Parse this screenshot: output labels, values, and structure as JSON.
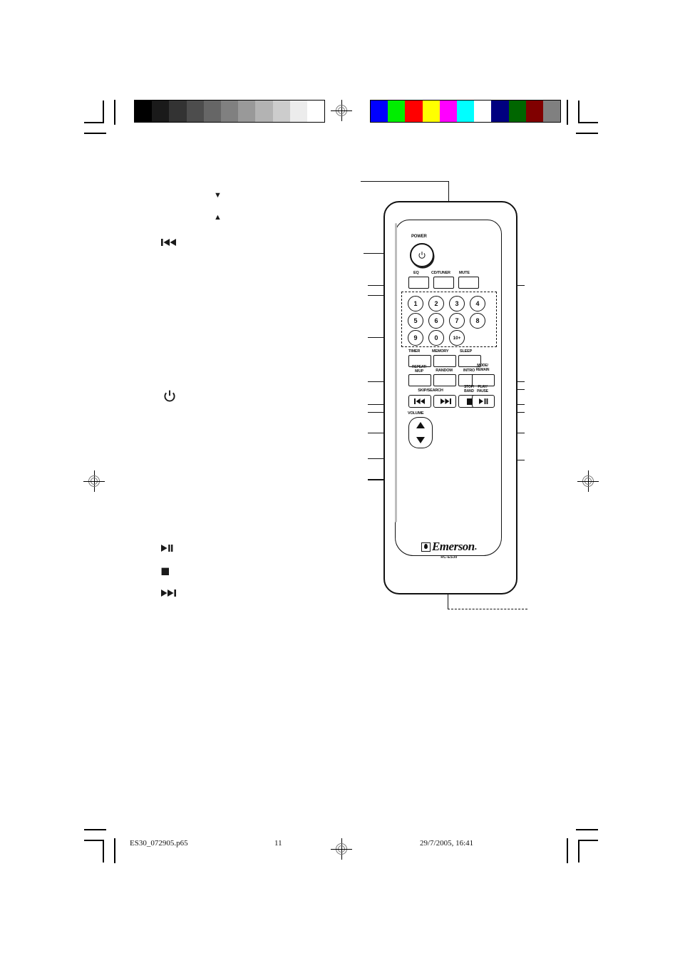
{
  "page": {
    "number": "11",
    "footer_file": "ES30_072905.p65",
    "footer_date": "29/7/2005, 16:41"
  },
  "calibration": {
    "grayscale_label": "grayscale-calibration-bar",
    "grayscale_swatches": [
      "#000000",
      "#1a1a1a",
      "#333333",
      "#4d4d4d",
      "#666666",
      "#808080",
      "#999999",
      "#b3b3b3",
      "#cccccc",
      "#ececec",
      "#ffffff"
    ],
    "color_label": "color-calibration-bar",
    "color_swatches": [
      "#0000ff",
      "#00ee00",
      "#ff0000",
      "#ffff00",
      "#ff00ff",
      "#00ffff",
      "#ffffff",
      "#000080",
      "#006600",
      "#800000",
      "#808080"
    ]
  },
  "remote": {
    "brand": "Emerson",
    "model": "RC-ES30",
    "power_label": "POWER",
    "row_mode": [
      {
        "label": "EQ"
      },
      {
        "label": "CD/TUNER"
      },
      {
        "label": "MUTE"
      }
    ],
    "keypad": [
      "1",
      "2",
      "3",
      "4",
      "5",
      "6",
      "7",
      "8",
      "9",
      "0",
      "10+"
    ],
    "row_timer": [
      {
        "label": "TIMER"
      },
      {
        "label": "MEMORY"
      },
      {
        "label": "SLEEP"
      }
    ],
    "row_repeat": [
      {
        "label_line1": "REPEAT/",
        "label_line2": "M/UP"
      },
      {
        "label_line1": "RANDOM",
        "label_line2": ""
      },
      {
        "label_line1": "INTRO",
        "label_line2": ""
      },
      {
        "label_line1": "MODE/",
        "label_line2": "REMAIN"
      }
    ],
    "row_transport": {
      "skip_search_label": "SKIP/SEARCH",
      "stop_band_line1": "STOP/",
      "stop_band_line2": "BAND",
      "play_pause_line1": "PLAY/",
      "play_pause_line2": "PAUSE",
      "skip_back_glyph": "◀◀",
      "skip_fwd_glyph": "▶▶",
      "stop_glyph": "■",
      "play_pause_glyph": "▶‖"
    },
    "volume_label": "VOLUME",
    "volume_up_glyph": "up-triangle",
    "volume_down_glyph": "down-triangle"
  },
  "left_symbols": [
    {
      "name": "down-triangle-symbol",
      "glyph": "▼"
    },
    {
      "name": "up-triangle-symbol",
      "glyph": "▲"
    },
    {
      "name": "skip-back-symbol",
      "glyph": "◀◀▐"
    },
    {
      "name": "power-symbol",
      "glyph": "power"
    },
    {
      "name": "play-pause-symbol",
      "glyph": "▶▐▐"
    },
    {
      "name": "stop-symbol",
      "glyph": "■"
    },
    {
      "name": "skip-forward-symbol",
      "glyph": "▌▶▶"
    }
  ]
}
